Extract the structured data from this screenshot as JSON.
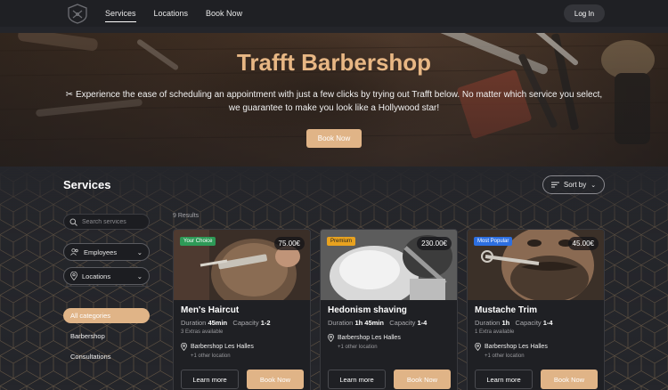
{
  "nav": {
    "links": [
      "Services",
      "Locations",
      "Book Now"
    ],
    "login": "Log In"
  },
  "hero": {
    "title": "Trafft Barbershop",
    "line1": "✂ Experience the ease of scheduling an appointment with just a few clicks by trying out Trafft below. No matter which service you select,",
    "line2": "we guarantee to make you look like a Hollywood star!",
    "button": "Book Now"
  },
  "main": {
    "title": "Services",
    "sort_label": "Sort by",
    "results": "9 Results"
  },
  "sidebar": {
    "search_placeholder": "Search services",
    "employees": "Employees",
    "locations": "Locations",
    "categories": [
      "All categories",
      "Barbershop",
      "Consultations"
    ]
  },
  "cards": [
    {
      "badge": "Your Choice",
      "badge_color": "#2e9a57",
      "price": "75.00€",
      "name": "Men's Haircut",
      "duration_label": "Duration",
      "duration": "45min",
      "capacity_label": "Capacity",
      "capacity": "1-2",
      "extras": "3 Extras available",
      "location": "Barbershop Les Halles",
      "other_location": "+1 other location",
      "learn": "Learn more",
      "book": "Book Now"
    },
    {
      "badge": "Premium",
      "badge_color": "#e8a21f",
      "price": "230.00€",
      "name": "Hedonism shaving",
      "duration_label": "Duration",
      "duration": "1h 45min",
      "capacity_label": "Capacity",
      "capacity": "1-4",
      "extras": "",
      "location": "Barbershop Les Halles",
      "other_location": "+1 other location",
      "learn": "Learn more",
      "book": "Book Now"
    },
    {
      "badge": "Most Popular",
      "badge_color": "#2d6fe0",
      "price": "45.00€",
      "name": "Mustache Trim",
      "duration_label": "Duration",
      "duration": "1h",
      "capacity_label": "Capacity",
      "capacity": "1-4",
      "extras": "1 Extra available",
      "location": "Barbershop Les Halles",
      "other_location": "+1 other location",
      "learn": "Learn more",
      "book": "Book Now"
    }
  ],
  "colors": {
    "accent": "#e0b487",
    "background": "#25262b",
    "nav": "#1f2024"
  }
}
